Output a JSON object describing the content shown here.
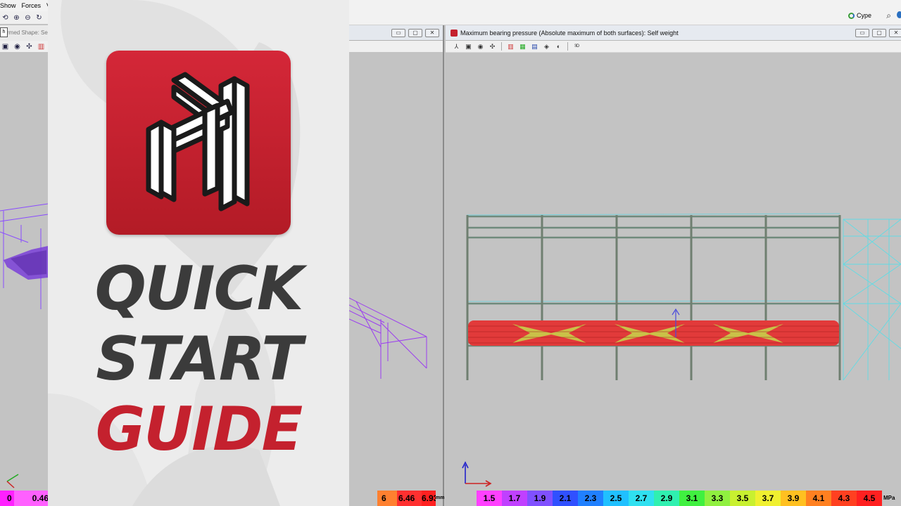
{
  "left_app": {
    "menu": [
      "Show",
      "Forces",
      "V"
    ],
    "tab_tip": "h",
    "tab_label": "rmed Shape: Se",
    "scale_values": [
      "0",
      "0.46"
    ]
  },
  "card": {
    "line1": "QUICK",
    "line2": "START",
    "line3": "GUIDE",
    "accent_color": "#c4212e"
  },
  "top_bar": {
    "cype_label": "Cype"
  },
  "middle_window": {
    "scale_values": [
      "6",
      "6.46",
      "6.93"
    ],
    "unit": "mm"
  },
  "main_window": {
    "title": "Maximum bearing pressure (Absolute maximum of both surfaces): Self weight",
    "toolbar_icons": [
      "axis-icon",
      "cube-icon",
      "eye-icon",
      "move-icon",
      "grid-red-icon",
      "grid-green-icon",
      "grid-blue-icon",
      "box-icon",
      "hide-icon",
      "3d-icon"
    ],
    "scale_values": [
      "1.5",
      "1.7",
      "1.9",
      "2.1",
      "2.3",
      "2.5",
      "2.7",
      "2.9",
      "3.1",
      "3.3",
      "3.5",
      "3.7",
      "3.9",
      "4.1",
      "4.3",
      "4.5"
    ],
    "scale_colors": [
      "#ff40ff",
      "#c040ff",
      "#8050ff",
      "#3050ff",
      "#2080ff",
      "#20c0ff",
      "#30e0f0",
      "#30f0b0",
      "#40f040",
      "#90f040",
      "#c8f030",
      "#f0f030",
      "#ffc020",
      "#ff8020",
      "#ff4020",
      "#ff2020"
    ],
    "unit": "MPa"
  }
}
